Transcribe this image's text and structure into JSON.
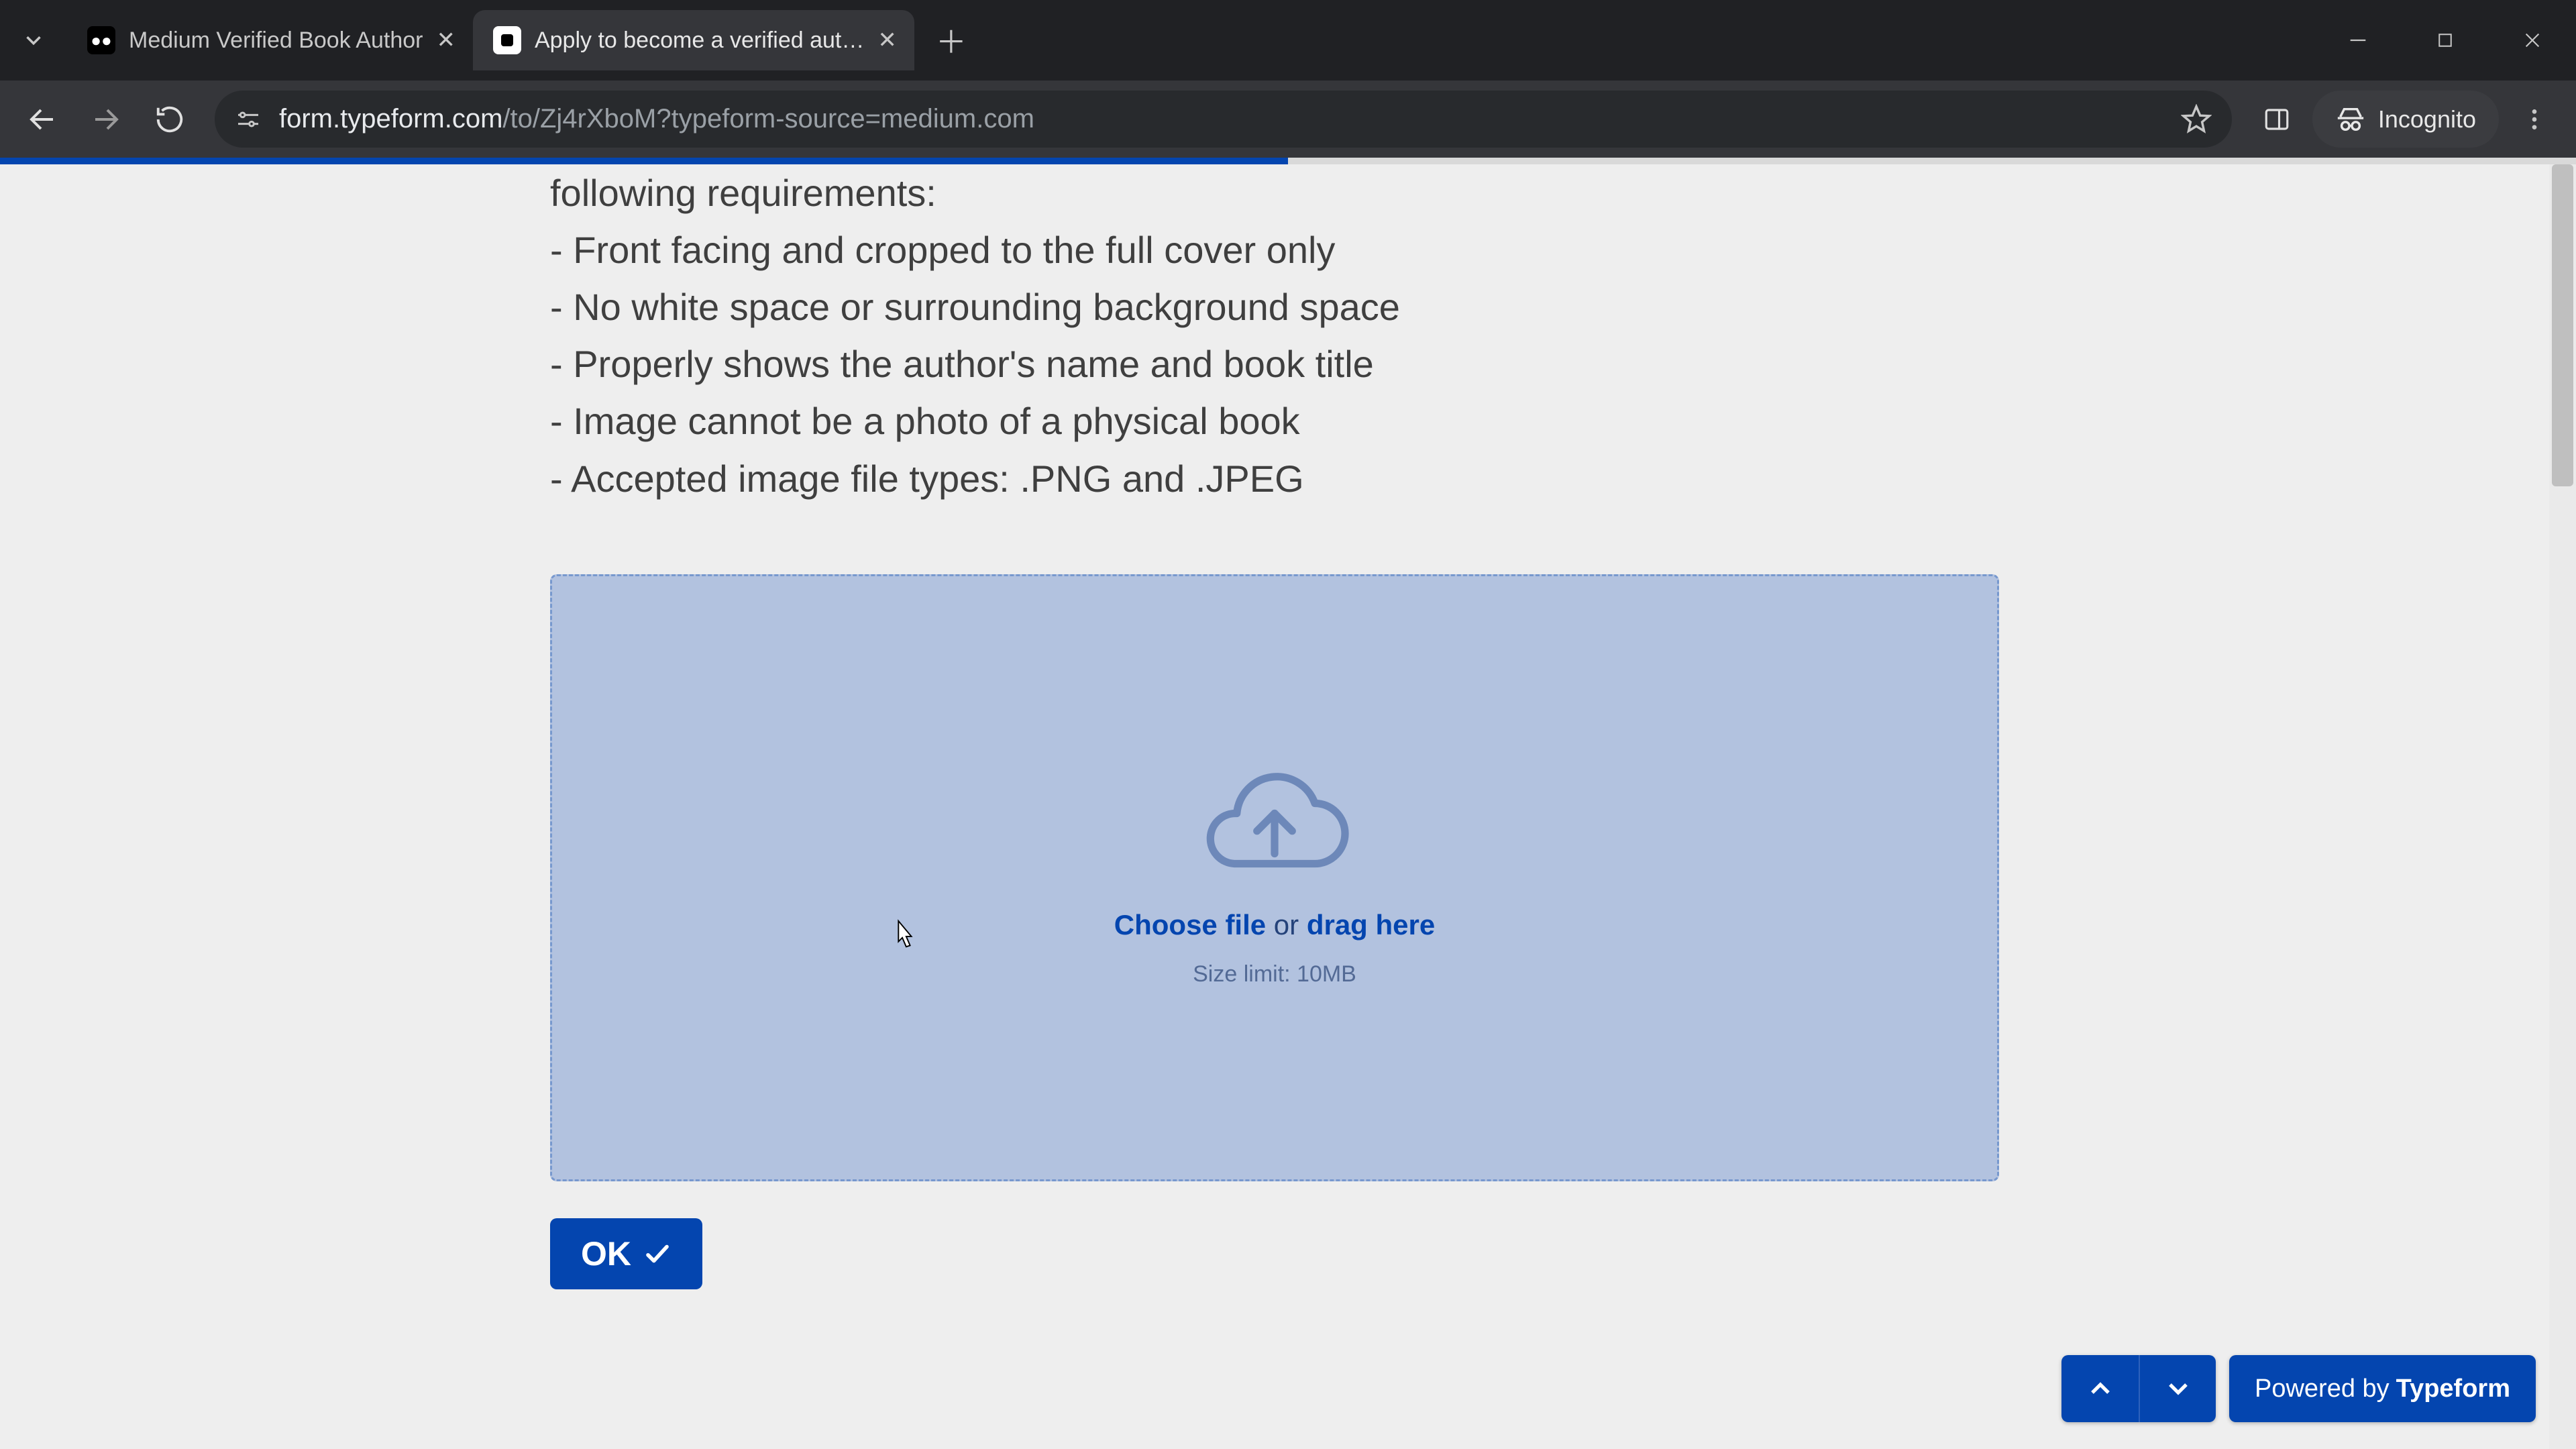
{
  "browser": {
    "tabs": [
      {
        "title": "Medium Verified Book Author",
        "active": false
      },
      {
        "title": "Apply to become a verified aut…",
        "active": true
      }
    ],
    "url_host": "form.typeform.com",
    "url_path": "/to/Zj4rXboM?typeform-source=medium.com",
    "incognito_label": "Incognito"
  },
  "page": {
    "progress_percent": 50,
    "requirements_intro": "following requirements:",
    "requirements": [
      "- Front facing and cropped to the full cover only",
      "- No white space or surrounding background space",
      "- Properly shows the author's name and book title",
      "- Image cannot be a photo of a physical book",
      "- Accepted image file types: .PNG and .JPEG"
    ],
    "dropzone": {
      "choose_file": "Choose file",
      "or": " or ",
      "drag_here": "drag here",
      "size_limit": "Size limit: 10MB"
    },
    "ok_label": "OK",
    "powered_prefix": "Powered by ",
    "powered_brand": "Typeform"
  },
  "colors": {
    "accent": "#0445af",
    "page_bg": "#eeeeee",
    "dropzone_bg": "#b2c2df"
  }
}
